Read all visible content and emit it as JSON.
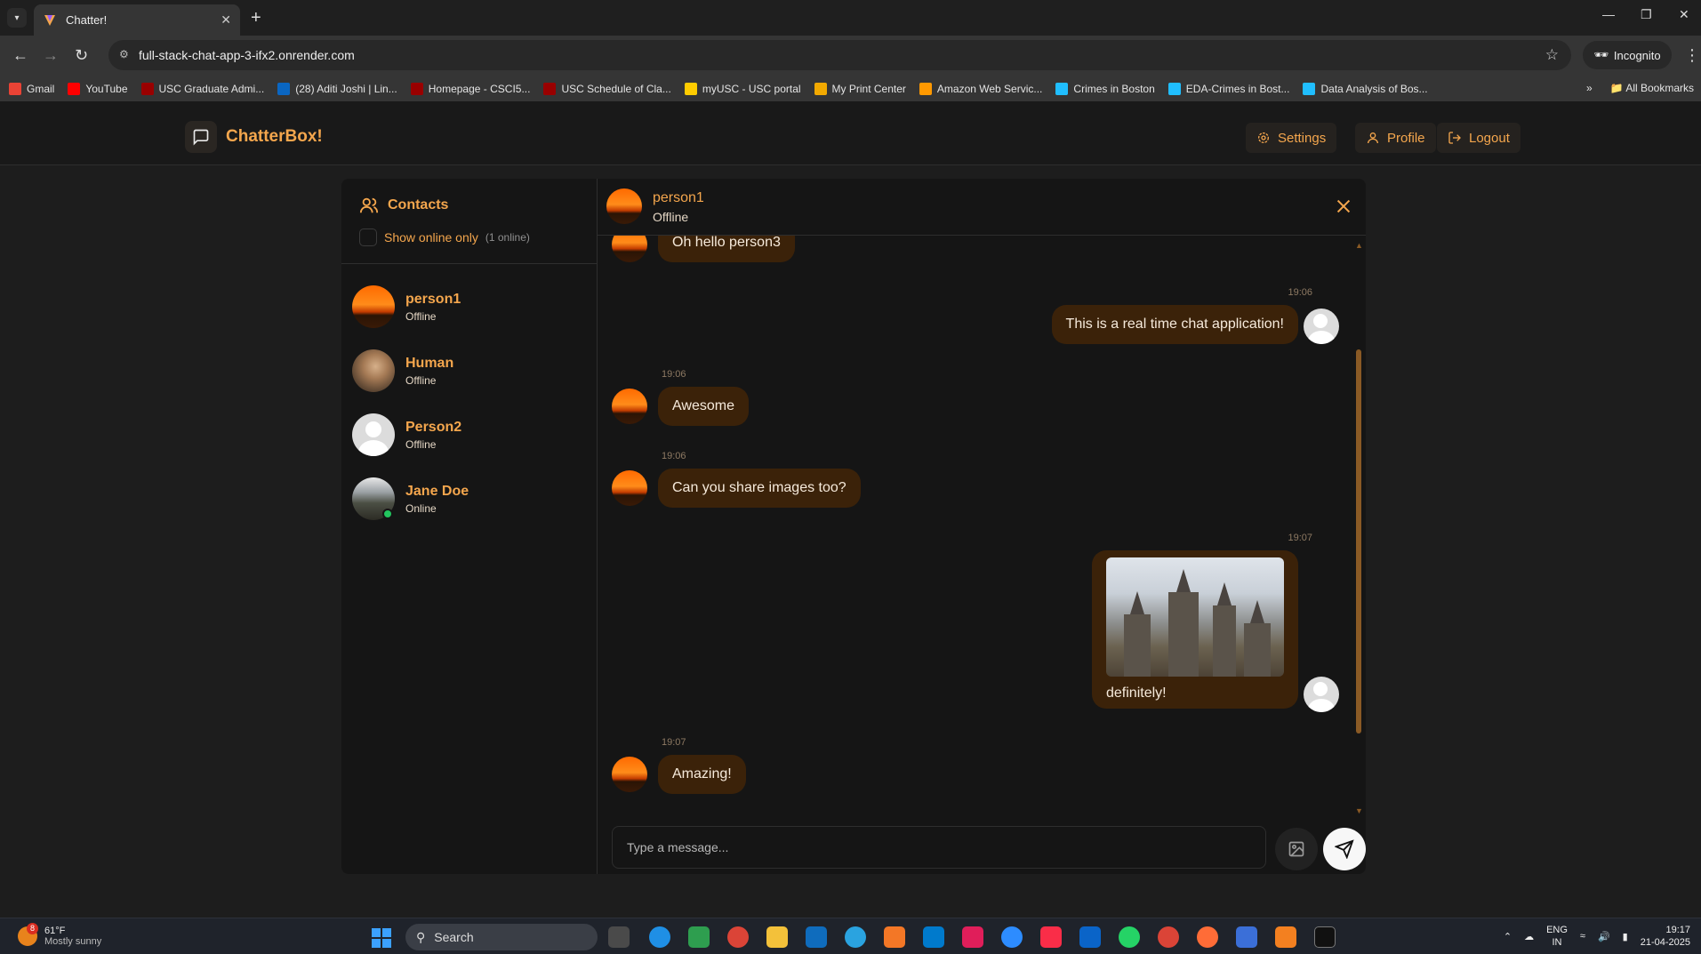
{
  "browser": {
    "tab_title": "Chatter!",
    "url": "full-stack-chat-app-3-ifx2.onrender.com",
    "incognito_label": "Incognito",
    "bookmarks": [
      {
        "label": "Gmail",
        "color": "#ea4335"
      },
      {
        "label": "YouTube",
        "color": "#ff0000"
      },
      {
        "label": "USC Graduate Admi...",
        "color": "#990000"
      },
      {
        "label": "(28) Aditi Joshi | Lin...",
        "color": "#0a66c2"
      },
      {
        "label": "Homepage - CSCI5...",
        "color": "#990000"
      },
      {
        "label": "USC Schedule of Cla...",
        "color": "#990000"
      },
      {
        "label": "myUSC - USC portal",
        "color": "#ffcc00"
      },
      {
        "label": "My Print Center",
        "color": "#f2a900"
      },
      {
        "label": "Amazon Web Servic...",
        "color": "#ff9900"
      },
      {
        "label": "Crimes in Boston",
        "color": "#20beff"
      },
      {
        "label": "EDA-Crimes in Bost...",
        "color": "#20beff"
      },
      {
        "label": "Data Analysis of Bos...",
        "color": "#20beff"
      }
    ],
    "all_bookmarks_label": "All Bookmarks"
  },
  "header": {
    "brand": "ChatterBox!",
    "settings_label": "Settings",
    "profile_label": "Profile",
    "logout_label": "Logout"
  },
  "sidebar": {
    "title": "Contacts",
    "filter_label": "Show online only",
    "online_count": "(1 online)",
    "contacts": [
      {
        "name": "person1",
        "status": "Offline",
        "avatar": "sunset"
      },
      {
        "name": "Human",
        "status": "Offline",
        "avatar": "photo"
      },
      {
        "name": "Person2",
        "status": "Offline",
        "avatar": "default-user-icon"
      },
      {
        "name": "Jane Doe",
        "status": "Online",
        "avatar": "photo"
      }
    ]
  },
  "chat": {
    "name": "person1",
    "status": "Offline",
    "messages": [
      {
        "from": "them",
        "time": "",
        "text": "Oh hello person3"
      },
      {
        "from": "me",
        "time": "19:06",
        "text": "This is a real time chat application!"
      },
      {
        "from": "them",
        "time": "19:06",
        "text": "Awesome"
      },
      {
        "from": "them",
        "time": "19:06",
        "text": "Can you share images too?"
      },
      {
        "from": "me",
        "time": "19:07",
        "text": "definitely!",
        "image": "castle-photo"
      },
      {
        "from": "them",
        "time": "19:07",
        "text": "Amazing!"
      }
    ],
    "input_placeholder": "Type a message..."
  },
  "taskbar": {
    "weather_temp": "61°F",
    "weather_desc": "Mostly sunny",
    "weather_badge": "8",
    "search_label": "Search",
    "lang_top": "ENG",
    "lang_bottom": "IN",
    "time": "19:17",
    "date": "21-04-2025"
  },
  "colors": {
    "accent": "#f4a64d",
    "bubble": "#3b2209",
    "online": "#22c55e"
  }
}
